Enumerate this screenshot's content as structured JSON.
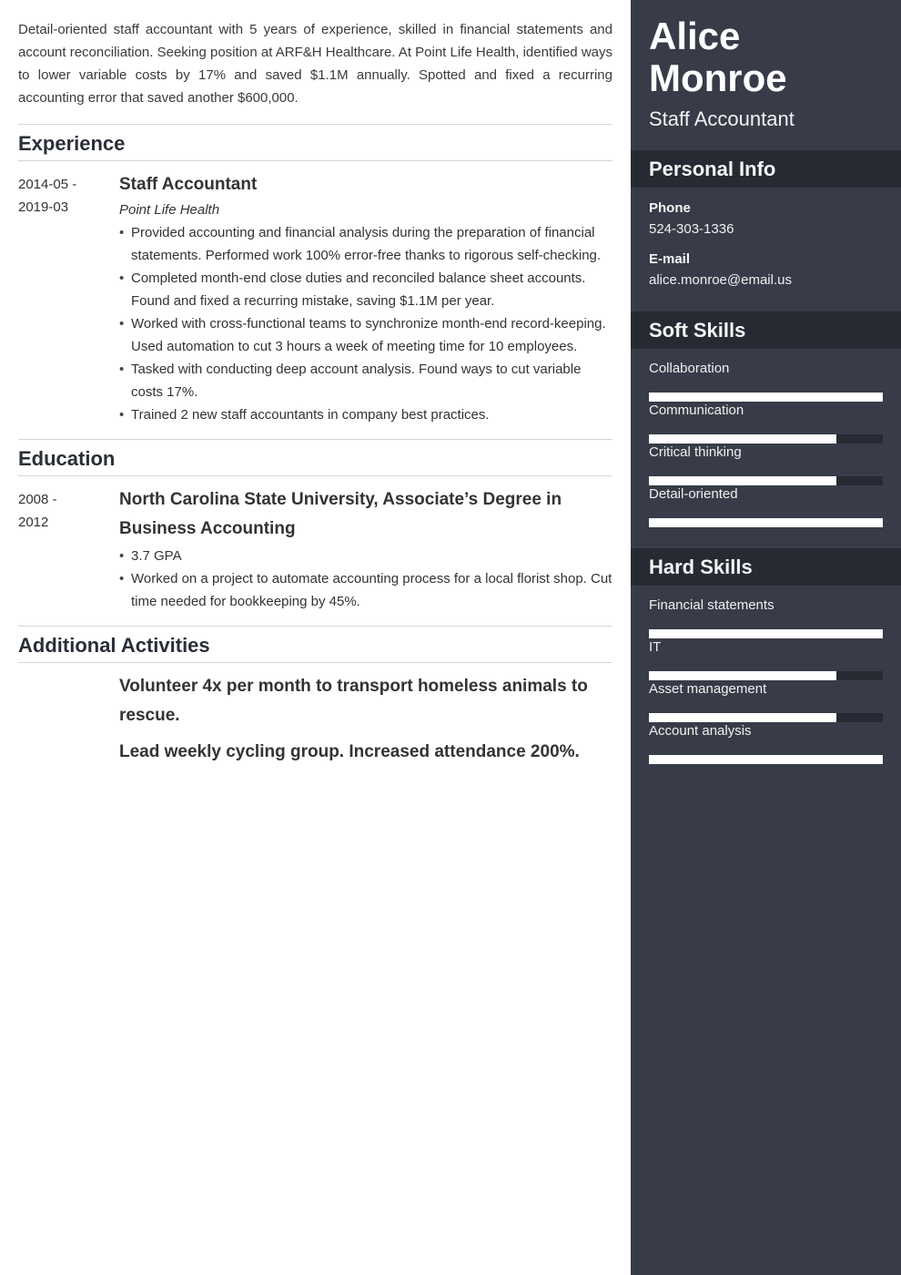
{
  "summary": "Detail-oriented staff accountant with 5 years of experience, skilled in financial statements and account reconciliation. Seeking position at ARF&H Healthcare. At Point Life Health, identified ways to lower variable costs by 17% and saved $1.1M annually. Spotted and fixed a recurring accounting error that saved another $600,000.",
  "sections": {
    "experience": "Experience",
    "education": "Education",
    "activities": "Additional Activities"
  },
  "experience": [
    {
      "date_start": "2014-05 -",
      "date_end": "2019-03",
      "title": "Staff Accountant",
      "company": "Point Life Health",
      "bullets": [
        "Provided accounting and financial analysis during the preparation of financial statements. Performed work 100% error-free thanks to rigorous self-checking.",
        "Completed month-end close duties and reconciled balance sheet accounts. Found and fixed a recurring mistake, saving $1.1M per year.",
        "Worked with cross-functional teams to synchronize month-end record-keeping. Used automation to cut 3 hours a week of meeting time for 10 employees.",
        "Tasked with conducting deep account analysis. Found ways to cut variable costs 17%.",
        "Trained 2 new staff accountants in company best practices."
      ]
    }
  ],
  "education": [
    {
      "date_start": "2008 -",
      "date_end": "2012",
      "title": "North Carolina State University, Associate’s Degree in Business Accounting",
      "bullets": [
        "3.7 GPA",
        "Worked on a project to automate accounting process for a local florist shop. Cut time needed for bookkeeping by 45%."
      ]
    }
  ],
  "activities": [
    "Volunteer 4x per month to transport homeless animals to rescue.",
    "Lead weekly cycling group. Increased attendance 200%."
  ],
  "sidebar": {
    "name": "Alice Monroe",
    "role": "Staff Accountant",
    "personal_info": {
      "heading": "Personal Info",
      "phone_label": "Phone",
      "phone": "524-303-1336",
      "email_label": "E-mail",
      "email": "alice.monroe@email.us"
    },
    "soft_skills": {
      "heading": "Soft Skills",
      "items": [
        {
          "name": "Collaboration",
          "level": 1.0
        },
        {
          "name": "Communication",
          "level": 0.8
        },
        {
          "name": "Critical thinking",
          "level": 0.8
        },
        {
          "name": "Detail-oriented",
          "level": 1.0
        }
      ]
    },
    "hard_skills": {
      "heading": "Hard Skills",
      "items": [
        {
          "name": "Financial statements",
          "level": 1.0
        },
        {
          "name": "IT",
          "level": 0.8
        },
        {
          "name": "Asset management",
          "level": 0.8
        },
        {
          "name": "Account analysis",
          "level": 1.0
        }
      ]
    }
  },
  "colors": {
    "sidebar_bg": "#373c48",
    "sidebar_header_bg": "#262a33",
    "skill_fill": "#ffffff",
    "heading_text": "#2a2e37"
  }
}
